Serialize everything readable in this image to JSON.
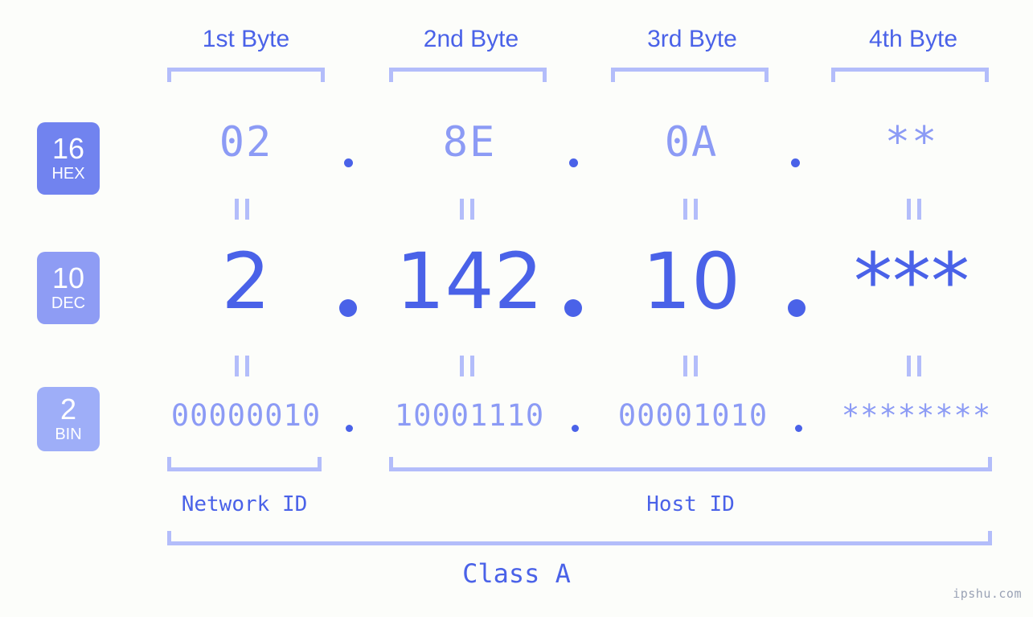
{
  "background_color": "#fcfdfa",
  "accent_color": "#4a62e8",
  "accent_light_color": "#8c9bf5",
  "bracket_color": "#b3bdfa",
  "headers": {
    "byte1": "1st Byte",
    "byte2": "2nd Byte",
    "byte3": "3rd Byte",
    "byte4": "4th Byte"
  },
  "bases": [
    {
      "number": "16",
      "name": "HEX",
      "color": "#7183ef"
    },
    {
      "number": "10",
      "name": "DEC",
      "color": "#8e9cf4"
    },
    {
      "number": "2",
      "name": "BIN",
      "color": "#9eaef8"
    }
  ],
  "rows": {
    "hex": {
      "base_number": "16",
      "base_name": "HEX",
      "values": [
        "02",
        "8E",
        "0A",
        "**"
      ],
      "separator": "."
    },
    "dec": {
      "base_number": "10",
      "base_name": "DEC",
      "values": [
        "2",
        "142",
        "10",
        "***"
      ],
      "separator": "."
    },
    "bin": {
      "base_number": "2",
      "base_name": "BIN",
      "values": [
        "00000010",
        "10001110",
        "00001010",
        "********"
      ],
      "separator": "."
    }
  },
  "equality_symbol": "=",
  "sections": {
    "network_id": "Network ID",
    "host_id": "Host ID"
  },
  "class_label": "Class A",
  "watermark": "ipshu.com"
}
